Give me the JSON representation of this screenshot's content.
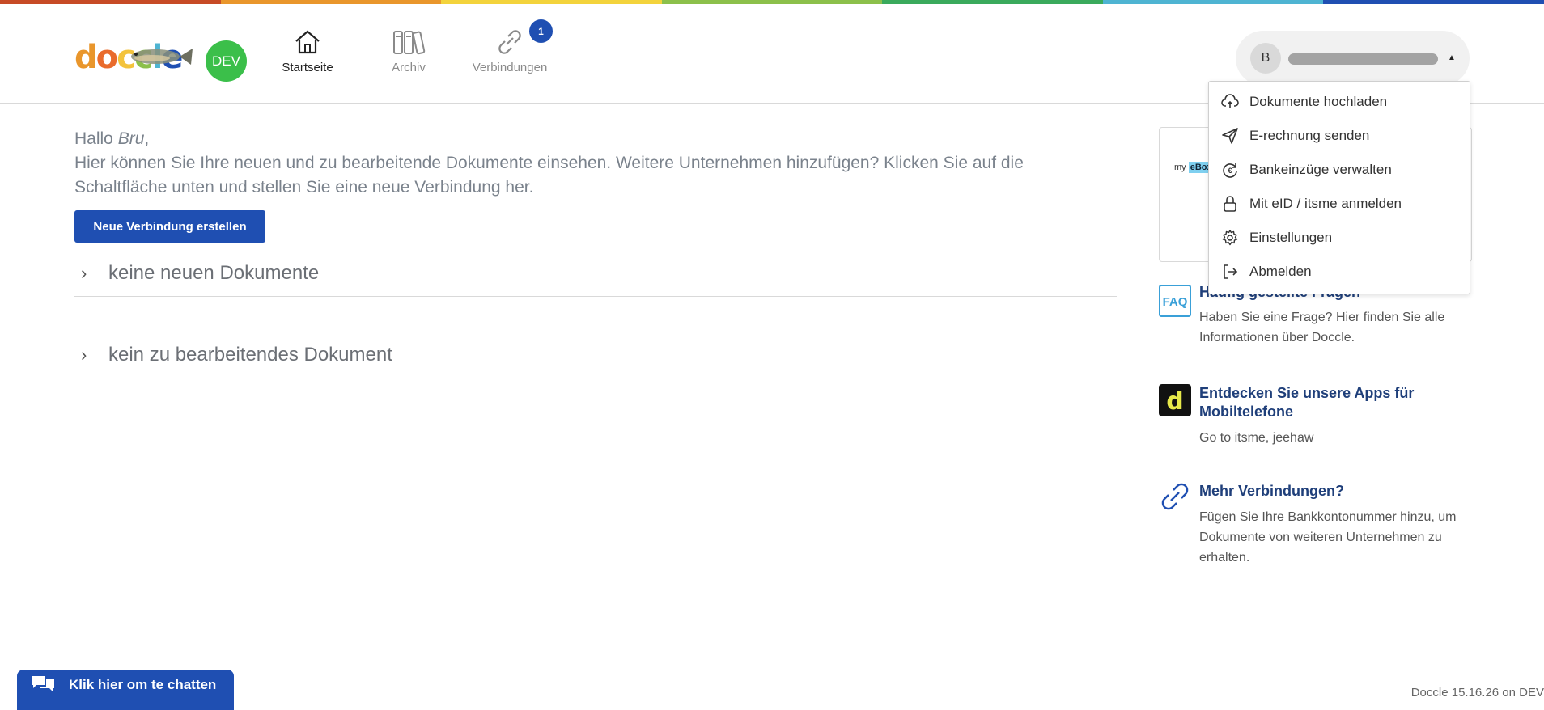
{
  "colors": {
    "rainbow": [
      "#c74b26",
      "#e9962c",
      "#f3d33c",
      "#8cc04b",
      "#3aaa5c",
      "#4eb4d2",
      "#1f4fb2"
    ],
    "accent": "#1f4fb2",
    "env_badge": "#3bbf4a"
  },
  "header": {
    "logo_text": "doccle",
    "env_badge": "DEV",
    "nav": [
      {
        "label": "Startseite",
        "icon": "home-icon",
        "active": true
      },
      {
        "label": "Archiv",
        "icon": "archive-icon",
        "active": false
      },
      {
        "label": "Verbindungen",
        "icon": "link-icon",
        "active": false,
        "badge": "1"
      }
    ],
    "user": {
      "avatar_initial": "B"
    }
  },
  "main": {
    "greeting_prefix": "Hallo ",
    "greeting_name": "Bru",
    "greeting_suffix": ",",
    "intro": "Hier können Sie Ihre neuen und zu bearbeitende Dokumente einsehen. Weitere Unternehmen hinzufügen? Klicken Sie auf die Schaltfläche unten und stellen Sie eine neue Verbindung her.",
    "new_connection_button": "Neue Verbindung erstellen",
    "sections": [
      {
        "label": "keine neuen Dokumente"
      },
      {
        "label": "kein zu bearbeitendes Dokument"
      }
    ]
  },
  "sidebar": {
    "promo": {
      "prefix": "my",
      "highlight": "eBox"
    },
    "faq": {
      "icon_text": "FAQ",
      "title": "Häufig gestellte Fragen",
      "text": "Haben Sie eine Frage? Hier finden Sie alle Informationen über Doccle."
    },
    "apps": {
      "icon_text": "d",
      "title": "Entdecken Sie unsere Apps für Mobiltelefone",
      "text": "Go to itsme, jeehaw"
    },
    "connections": {
      "title": "Mehr Verbindungen?",
      "text": "Fügen Sie Ihre Bankkontonummer hinzu, um Dokumente von weiteren Unternehmen zu erhalten."
    }
  },
  "user_menu": {
    "items": [
      {
        "label": "Dokumente hochladen",
        "icon": "cloud-upload-icon"
      },
      {
        "label": "E-rechnung senden",
        "icon": "send-icon"
      },
      {
        "label": "Bankeinzüge verwalten",
        "icon": "euro-refresh-icon"
      },
      {
        "label": "Mit eID / itsme anmelden",
        "icon": "lock-icon"
      },
      {
        "label": "Einstellungen",
        "icon": "gear-icon"
      },
      {
        "label": "Abmelden",
        "icon": "logout-icon"
      }
    ]
  },
  "footer": {
    "chat_button": "Klik hier om te chatten",
    "version": "Doccle 15.16.26 on DEV"
  }
}
